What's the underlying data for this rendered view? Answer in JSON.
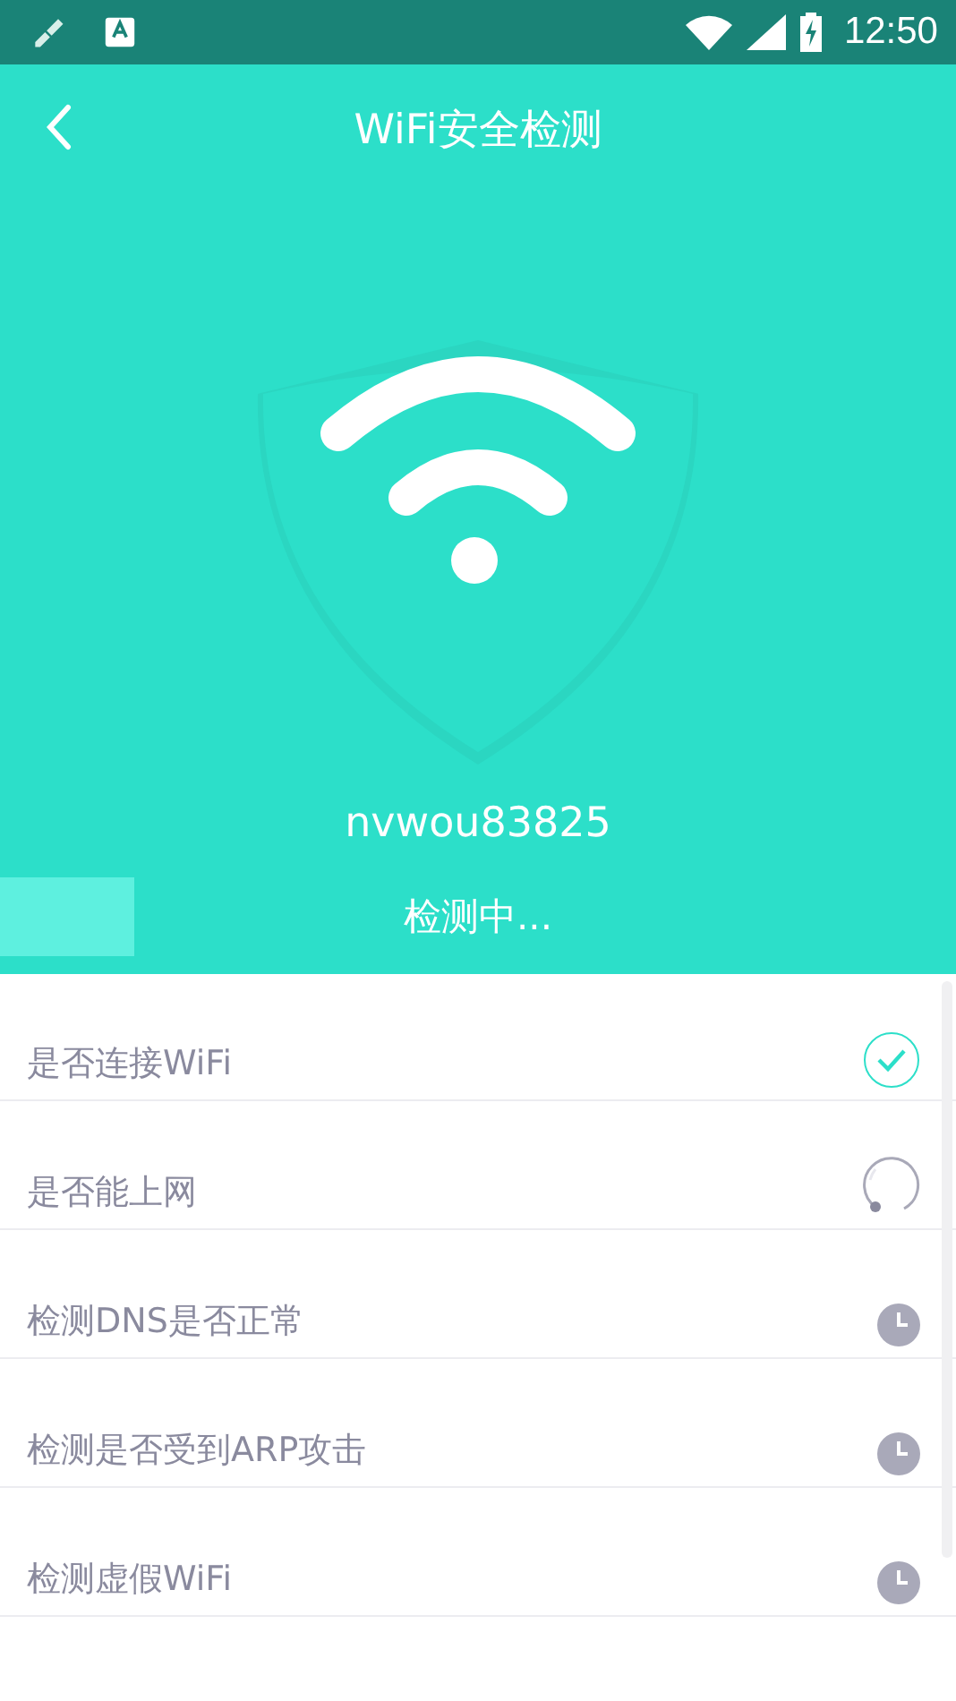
{
  "status_bar": {
    "time": "12:50"
  },
  "header": {
    "title": "WiFi安全检测"
  },
  "network": {
    "ssid": "nvwou83825"
  },
  "progress": {
    "level": 0.14,
    "label": "检测中..."
  },
  "checks": [
    {
      "label": "是否连接WiFi",
      "kind": "done"
    },
    {
      "label": "是否能上网",
      "kind": "loading"
    },
    {
      "label": "检测DNS是否正常",
      "kind": "waiting"
    },
    {
      "label": "检测是否受到ARP攻击",
      "kind": "waiting"
    },
    {
      "label": "检测虚假WiFi",
      "kind": "waiting"
    }
  ]
}
